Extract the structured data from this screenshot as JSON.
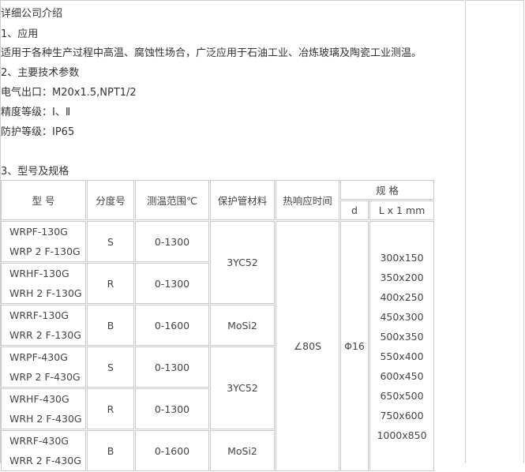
{
  "lines": {
    "title": "详细公司介绍",
    "h1": "1、应用",
    "p1": "适用于各种生产过程中高温、腐蚀性场合，广泛应用于石油工业、冶炼玻璃及陶瓷工业测温。",
    "h2": "2、主要技术参数",
    "p2": "电气出口：M20x1.5,NPT1/2",
    "p3": "精度等级：Ⅰ、Ⅱ",
    "p4": "防护等级：IP65",
    "h3": "3、型号及规格"
  },
  "table": {
    "headers": {
      "model": "型  号",
      "grade": "分度号",
      "range": "测温范围℃",
      "material": "保护管材料",
      "response": "热响应时间",
      "spec": "规  格",
      "d": "d",
      "lx": "L x 1 mm"
    },
    "rows": [
      {
        "m1": "WRPF-130G",
        "m2": "WRP 2 F-130G",
        "grade": "S",
        "range": "0-1300"
      },
      {
        "m1": "WRHF-130G",
        "m2": "WRH 2 F-130G",
        "grade": "R",
        "range": "0-1300"
      },
      {
        "m1": "WRRF-130G",
        "m2": "WRR 2 F-130G",
        "grade": "B",
        "range": "0-1600"
      },
      {
        "m1": "WRPF-430G",
        "m2": "WRP 2 F-430G",
        "grade": "S",
        "range": "0-1300"
      },
      {
        "m1": "WRHF-430G",
        "m2": "WRH 2 F-430G",
        "grade": "R",
        "range": "0-1300"
      },
      {
        "m1": "WRRF-430G",
        "m2": "WRR 2 F-430G",
        "grade": "B",
        "range": "0-1600"
      }
    ],
    "materials": [
      "3YC52",
      "MoSi2",
      "3YC52",
      "MoSi2"
    ],
    "response": "∠80S",
    "d": "Φ16",
    "lengths": [
      "300x150",
      "350x200",
      "400x250",
      "450x300",
      "500x350",
      "550x400",
      "600x450",
      "650x500",
      "750x600",
      "1000x850"
    ]
  }
}
